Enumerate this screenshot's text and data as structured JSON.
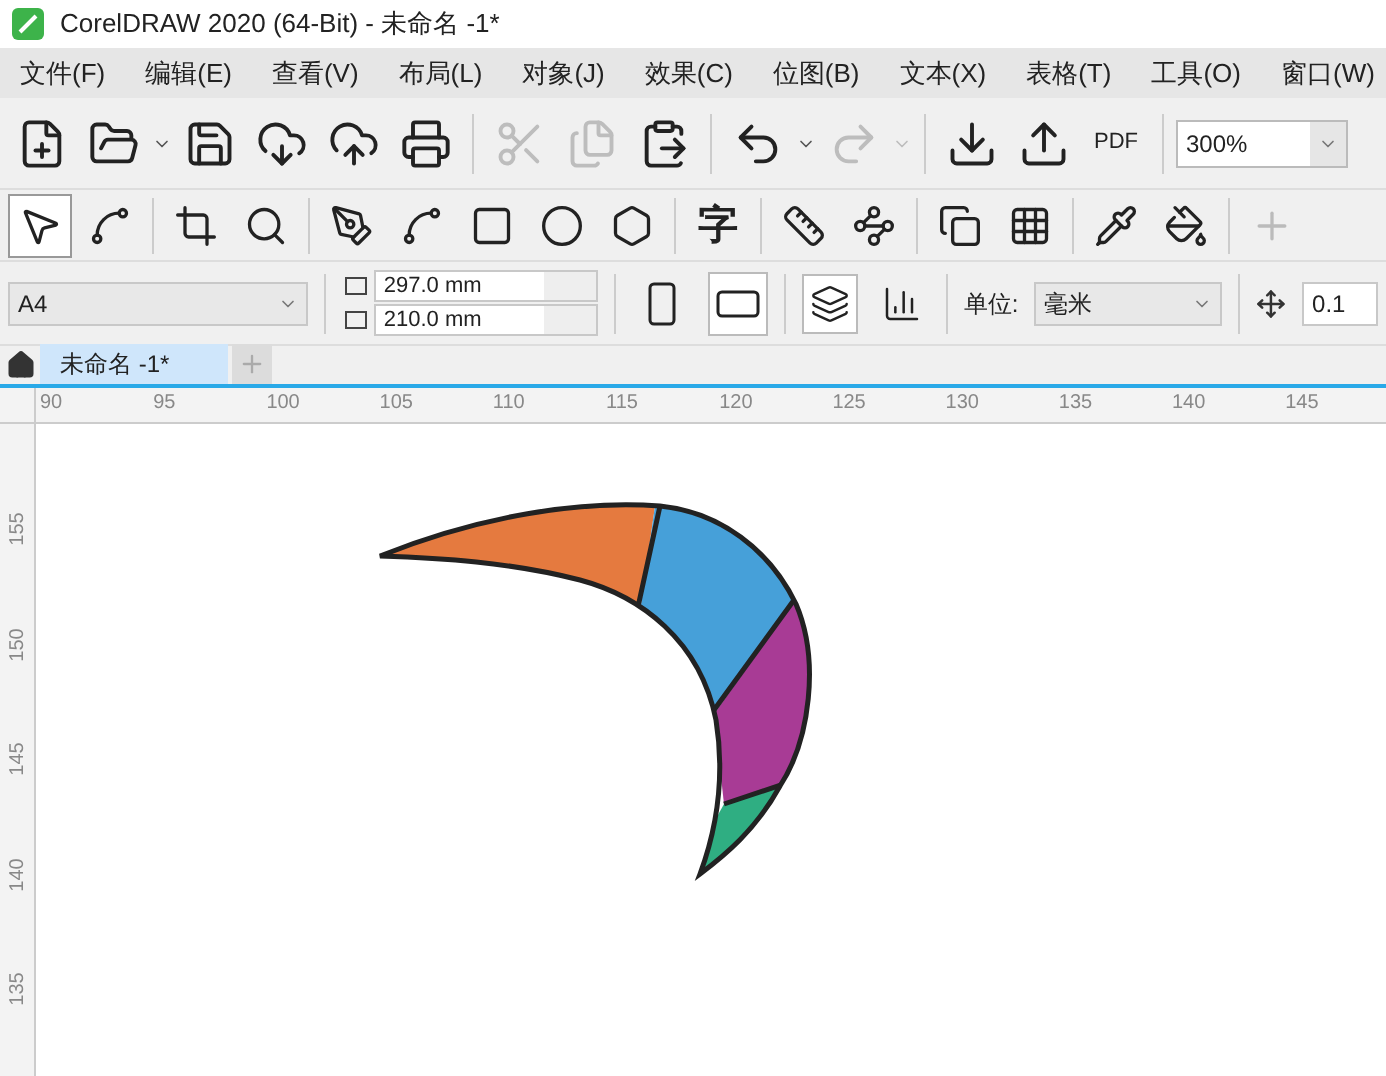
{
  "window": {
    "title": "CorelDRAW 2020 (64-Bit) - 未命名 -1*"
  },
  "menu": [
    "文件(F)",
    "编辑(E)",
    "查看(V)",
    "布局(L)",
    "对象(J)",
    "效果(C)",
    "位图(B)",
    "文本(X)",
    "表格(T)",
    "工具(O)",
    "窗口(W)"
  ],
  "standard_toolbar": {
    "items": [
      {
        "disabled": false
      },
      {
        "disabled": false
      },
      {
        "disabled": false
      },
      {
        "disabled": false
      },
      {
        "disabled": false
      },
      {
        "disabled": false
      },
      {
        "disabled": true
      },
      {
        "disabled": true
      },
      {
        "disabled": false
      },
      {
        "disabled": false
      },
      {
        "disabled": true
      },
      {
        "disabled": false
      },
      {
        "disabled": false
      },
      {
        "disabled": false
      }
    ],
    "pdf_label": "PDF",
    "zoom": "300%"
  },
  "toolbox": [
    {
      "selected": true
    },
    {
      "selected": false
    },
    {
      "selected": false
    },
    {
      "selected": false
    },
    {
      "selected": false
    },
    {
      "selected": false
    },
    {
      "selected": false
    },
    {
      "selected": false
    },
    {
      "selected": false
    },
    {
      "selected": false
    },
    {
      "selected": false
    },
    {
      "selected": false
    },
    {
      "selected": false
    },
    {
      "selected": false
    },
    {
      "selected": false
    },
    {
      "selected": false
    },
    {
      "selected": false
    }
  ],
  "text_tool_glyph": "字",
  "property_bar": {
    "page_size": "A4",
    "width": "297.0 mm",
    "height": "210.0 mm",
    "orientation": [
      {
        "selected": false
      },
      {
        "selected": true
      }
    ],
    "page_scope": [
      {
        "selected": true
      },
      {
        "selected": false
      }
    ],
    "unit_label": "单位:",
    "unit": "毫米",
    "nudge": "0.1"
  },
  "document_tabs": [
    {
      "label": "未命名 -1*",
      "selected": true
    }
  ],
  "horizontal_ruler": [
    "90",
    "95",
    "100",
    "105",
    "110",
    "115",
    "120",
    "125",
    "130",
    "135",
    "140",
    "145"
  ],
  "vertical_ruler": [
    "155",
    "150",
    "145",
    "140",
    "135"
  ],
  "drawing": {
    "segments": [
      {
        "color": "#e57a3f"
      },
      {
        "color": "#46a0d9"
      },
      {
        "color": "#a83b95"
      },
      {
        "color": "#2fae82"
      }
    ]
  }
}
